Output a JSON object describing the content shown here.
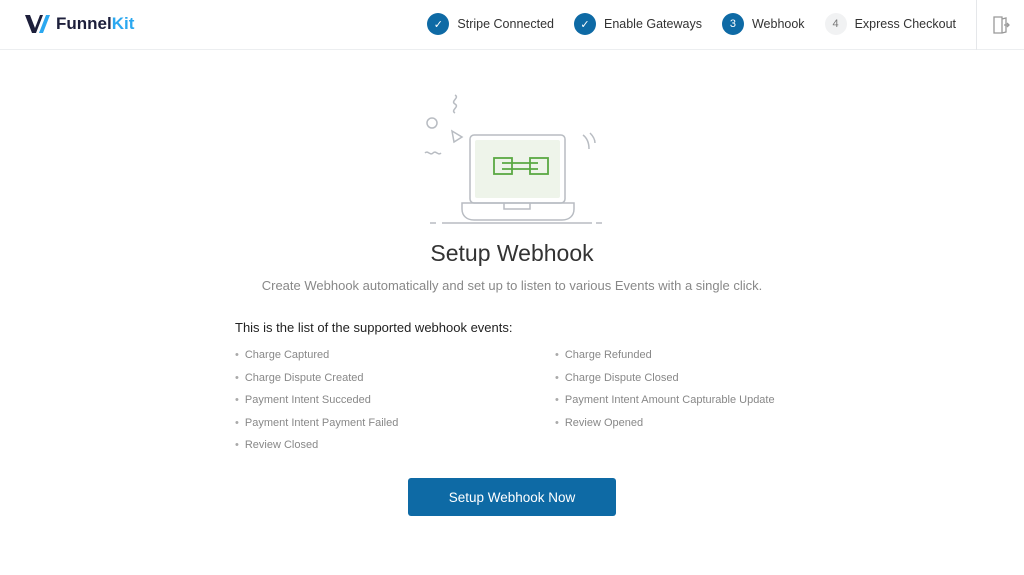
{
  "brand": {
    "name_a": "Funnel",
    "name_b": "Kit"
  },
  "steps": [
    {
      "label": "Stripe Connected",
      "state": "done",
      "marker": "✓"
    },
    {
      "label": "Enable Gateways",
      "state": "done",
      "marker": "✓"
    },
    {
      "label": "Webhook",
      "state": "active",
      "marker": "3"
    },
    {
      "label": "Express Checkout",
      "state": "todo",
      "marker": "4"
    }
  ],
  "main": {
    "title": "Setup Webhook",
    "subtitle": "Create Webhook automatically and set up to listen to various Events with a single click.",
    "list_heading": "This is the list of the supported webhook events:",
    "events_left": [
      "Charge Captured",
      "Charge Dispute Created",
      "Payment Intent Succeded",
      "Payment Intent Payment Failed",
      "Review Closed"
    ],
    "events_right": [
      "Charge Refunded",
      "Charge Dispute Closed",
      "Payment Intent Amount Capturable Update",
      "Review Opened"
    ],
    "button": "Setup Webhook Now"
  },
  "colors": {
    "primary": "#0e6aa5",
    "illustration_green": "#5aa843"
  }
}
